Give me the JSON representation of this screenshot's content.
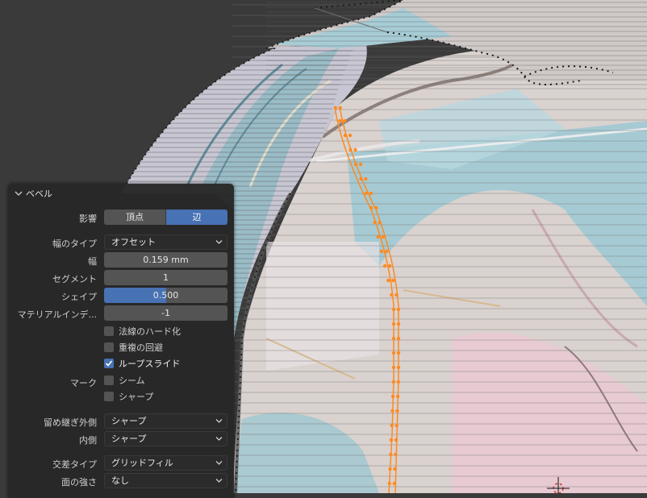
{
  "panel": {
    "title": "ベベル",
    "affect": {
      "label": "影響",
      "options": [
        "頂点",
        "辺"
      ],
      "active_index": 1
    },
    "width_type": {
      "label": "幅のタイプ",
      "value": "オフセット"
    },
    "width": {
      "label": "幅",
      "value": "0.159 mm"
    },
    "segments": {
      "label": "セグメント",
      "value": "1"
    },
    "shape": {
      "label": "シェイプ",
      "value": "0.500",
      "fraction": 0.5
    },
    "material_index": {
      "label": "マテリアルインデ...",
      "value": "-1"
    },
    "hard_normals": {
      "label": "法線のハード化",
      "checked": false
    },
    "clamp_overlap": {
      "label": "重複の回避",
      "checked": false
    },
    "loop_slide": {
      "label": "ループスライド",
      "checked": true
    },
    "mark": {
      "label": "マーク",
      "seam": {
        "label": "シーム",
        "checked": false
      },
      "sharp": {
        "label": "シャープ",
        "checked": false
      }
    },
    "miter_outer": {
      "label": "留め継ぎ外側",
      "value": "シャープ"
    },
    "miter_inner": {
      "label": "内側",
      "value": "シャープ"
    },
    "intersection_type": {
      "label": "交差タイプ",
      "value": "グリッドフィル"
    },
    "face_strength": {
      "label": "面の強さ",
      "value": "なし"
    }
  },
  "colors": {
    "accent": "#4772b3",
    "selected_edge": "#ff8a1f",
    "panel_bg": "#282828"
  }
}
